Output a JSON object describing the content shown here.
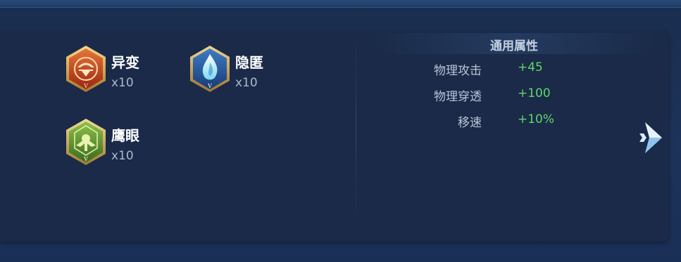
{
  "runes": [
    {
      "name": "异变",
      "count": "x10",
      "color": "#c2421e",
      "icon": "mutation-emblem-icon"
    },
    {
      "name": "隐匿",
      "count": "x10",
      "color": "#2a5a99",
      "icon": "stealth-emblem-icon"
    },
    {
      "name": "鹰眼",
      "count": "x10",
      "color": "#5a8a2a",
      "icon": "hawk-eye-emblem-icon"
    }
  ],
  "stats": {
    "title": "通用属性",
    "rows": [
      {
        "label": "物理攻击",
        "value": "+45"
      },
      {
        "label": "物理穿透",
        "value": "+100"
      },
      {
        "label": "移速",
        "value": "+10%"
      }
    ],
    "value_color": "#5ed66a"
  },
  "nav": {
    "next_icon": "chevron-right-icon"
  }
}
